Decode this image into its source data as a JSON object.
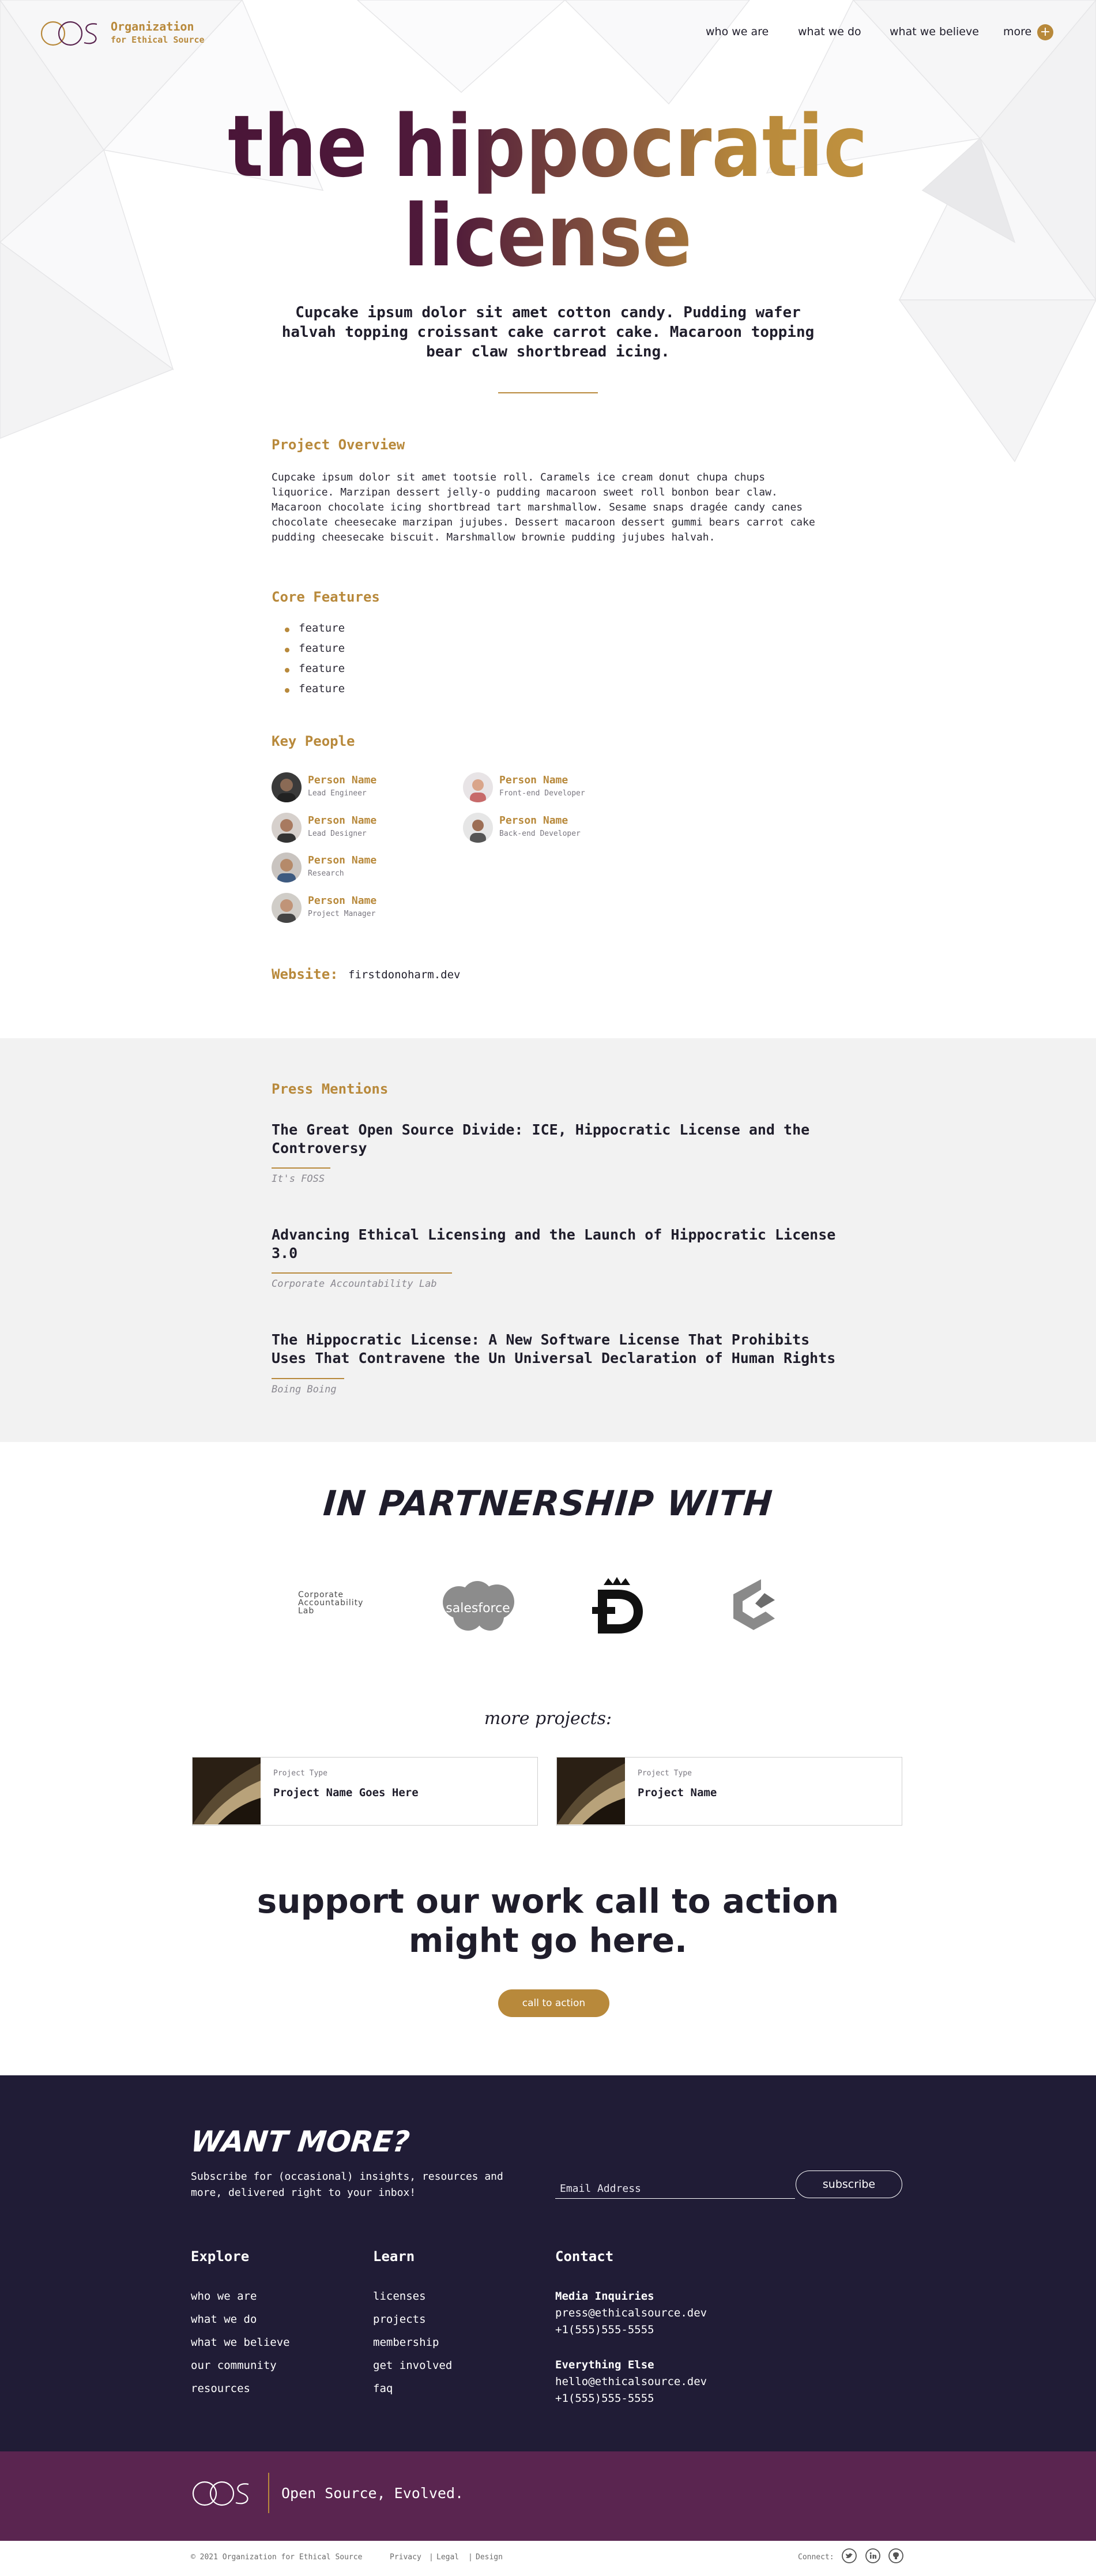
{
  "header": {
    "org_name": "Organization",
    "org_sub": "for Ethical Source",
    "nav": [
      "who we are",
      "what we do",
      "what we believe",
      "more"
    ],
    "more_icon": "plus-circle-icon"
  },
  "hero": {
    "title_line1": "the hippocratic",
    "title_line2": "license",
    "subtitle": "Cupcake ipsum dolor sit amet cotton candy. Pudding wafer halvah topping croissant cake carrot cake. Macaroon topping bear claw shortbread icing."
  },
  "overview": {
    "heading": "Project Overview",
    "body": "Cupcake ipsum dolor sit amet tootsie roll. Caramels ice cream donut chupa chups liquorice. Marzipan dessert jelly-o pudding macaroon sweet roll bonbon bear claw. Macaroon chocolate icing shortbread tart marshmallow. Sesame snaps dragée candy canes chocolate cheesecake marzipan jujubes. Dessert macaroon dessert gummi bears carrot cake pudding cheesecake biscuit. Marshmallow brownie pudding jujubes halvah."
  },
  "features": {
    "heading": "Core Features",
    "items": [
      "feature",
      "feature",
      "feature",
      "feature"
    ]
  },
  "people": {
    "heading": "Key People",
    "list": [
      {
        "name": "Person Name",
        "role": "Lead Engineer"
      },
      {
        "name": "Person Name",
        "role": "Front-end Developer"
      },
      {
        "name": "Person Name",
        "role": "Lead Designer"
      },
      {
        "name": "Person Name",
        "role": "Back-end Developer"
      },
      {
        "name": "Person Name",
        "role": "Research"
      },
      {
        "name": "Person Name",
        "role": "Project Manager"
      }
    ]
  },
  "website": {
    "label": "Website:",
    "value": "firstdonoharm.dev"
  },
  "press": {
    "heading": "Press Mentions",
    "items": [
      {
        "title": "The Great Open Source Divide: ICE, Hippocratic License and the Controversy",
        "source": "It's FOSS"
      },
      {
        "title": "Advancing Ethical Licensing and the Launch of Hippocratic License 3.0",
        "source": "Corporate Accountability Lab"
      },
      {
        "title": "The Hippocratic License: A New Software License That Prohibits Uses That Contravene the Un Universal Declaration of Human Rights",
        "source": "Boing Boing"
      }
    ]
  },
  "partners": {
    "heading": "IN PARTNERSHIP WITH",
    "cal_line1": "Corporate",
    "cal_line2": "Accountability",
    "cal_line3": "Lab",
    "salesforce": "salesforce",
    "logos": [
      "corporate-accountability-lab-logo",
      "salesforce-logo",
      "d-crown-logo",
      "c-hexagon-logo"
    ]
  },
  "projects": {
    "heading": "more projects:",
    "cards": [
      {
        "type": "Project Type",
        "name": "Project Name Goes Here"
      },
      {
        "type": "Project Type",
        "name": "Project Name"
      }
    ]
  },
  "cta": {
    "line1": "support our work call to action",
    "line2": "might go here.",
    "button": "call to action"
  },
  "footer": {
    "want_more": "WANT MORE?",
    "subscribe_text": "Subscribe for (occasional) insights, resources and more, delivered right to your inbox!",
    "email_placeholder": "Email Address",
    "subscribe_button": "subscribe",
    "explore": {
      "heading": "Explore",
      "links": [
        "who we are",
        "what we do",
        "what we believe",
        "our community",
        "resources"
      ]
    },
    "learn": {
      "heading": "Learn",
      "links": [
        "licenses",
        "projects",
        "membership",
        "get involved",
        "faq"
      ]
    },
    "contact": {
      "heading": "Contact",
      "media_label": "Media Inquiries",
      "media_email": "press@ethicalsource.dev",
      "media_phone": "+1(555)555-5555",
      "else_label": "Everything Else",
      "else_email": "hello@ethicalsource.dev",
      "else_phone": "+1(555)555-5555"
    },
    "tagline": "Open Source, Evolved.",
    "copyright": "© 2021 Organization for Ethical Source",
    "legal": [
      "Privacy",
      "Legal",
      "Design"
    ],
    "connect": "Connect:",
    "social": [
      "twitter-icon",
      "linkedin-icon",
      "github-icon"
    ]
  },
  "colors": {
    "gold": "#b8893b",
    "plum": "#4a1538",
    "footer_navy": "#201c36",
    "footer_purple": "#5a2550",
    "press_bg": "#f2f2f2"
  }
}
